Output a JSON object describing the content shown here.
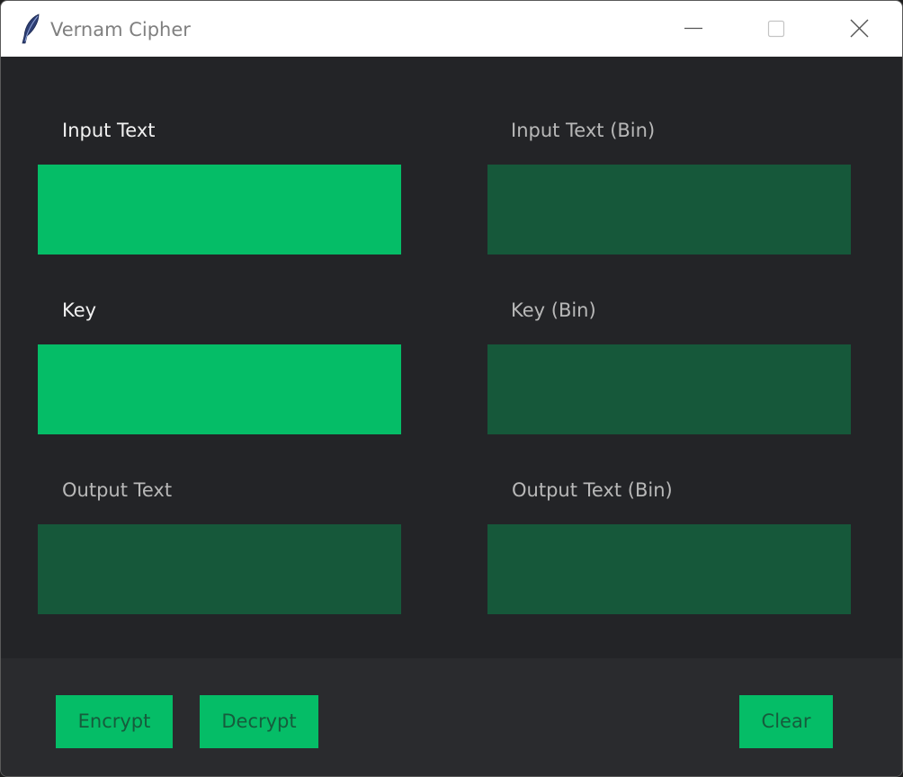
{
  "window": {
    "title": "Vernam Cipher",
    "icon": "feather-icon"
  },
  "controls": {
    "minimize_icon": "minimize-icon",
    "maximize_icon": "maximize-icon",
    "close_icon": "close-icon"
  },
  "left_column": {
    "input_label": "Input Text",
    "key_label": "Key",
    "output_label": "Output Text"
  },
  "right_column": {
    "input_bin_label": "Input Text (Bin)",
    "key_bin_label": "Key (Bin)",
    "output_bin_label": "Output Text (Bin)"
  },
  "buttons": {
    "encrypt": "Encrypt",
    "decrypt": "Decrypt",
    "clear": "Clear"
  },
  "colors": {
    "background": "#232427",
    "footer": "#2a2b2e",
    "accent_green": "#05bd67",
    "readonly_green": "#16583a",
    "button_text": "#165c3c"
  }
}
